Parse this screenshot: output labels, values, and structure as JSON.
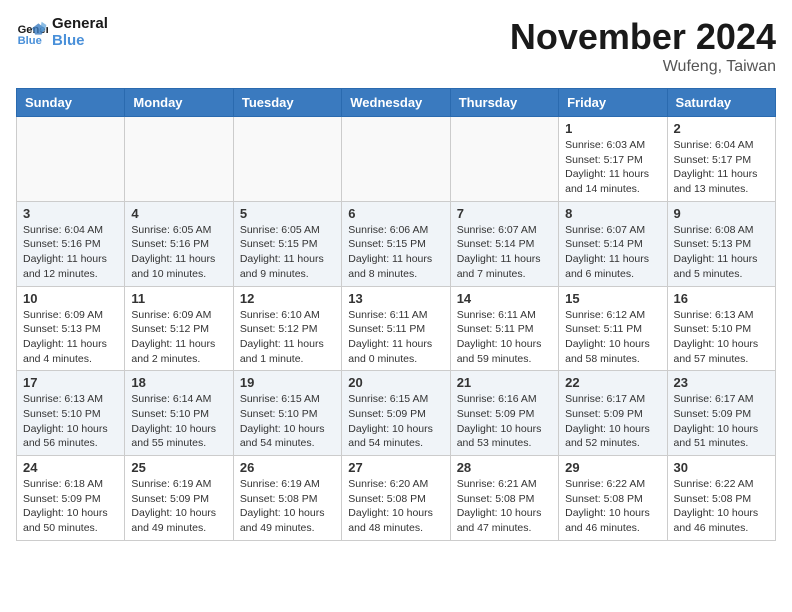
{
  "logo": {
    "line1": "General",
    "line2": "Blue"
  },
  "title": "November 2024",
  "location": "Wufeng, Taiwan",
  "days_header": [
    "Sunday",
    "Monday",
    "Tuesday",
    "Wednesday",
    "Thursday",
    "Friday",
    "Saturday"
  ],
  "weeks": [
    [
      {
        "day": "",
        "info": ""
      },
      {
        "day": "",
        "info": ""
      },
      {
        "day": "",
        "info": ""
      },
      {
        "day": "",
        "info": ""
      },
      {
        "day": "",
        "info": ""
      },
      {
        "day": "1",
        "info": "Sunrise: 6:03 AM\nSunset: 5:17 PM\nDaylight: 11 hours and 14 minutes."
      },
      {
        "day": "2",
        "info": "Sunrise: 6:04 AM\nSunset: 5:17 PM\nDaylight: 11 hours and 13 minutes."
      }
    ],
    [
      {
        "day": "3",
        "info": "Sunrise: 6:04 AM\nSunset: 5:16 PM\nDaylight: 11 hours and 12 minutes."
      },
      {
        "day": "4",
        "info": "Sunrise: 6:05 AM\nSunset: 5:16 PM\nDaylight: 11 hours and 10 minutes."
      },
      {
        "day": "5",
        "info": "Sunrise: 6:05 AM\nSunset: 5:15 PM\nDaylight: 11 hours and 9 minutes."
      },
      {
        "day": "6",
        "info": "Sunrise: 6:06 AM\nSunset: 5:15 PM\nDaylight: 11 hours and 8 minutes."
      },
      {
        "day": "7",
        "info": "Sunrise: 6:07 AM\nSunset: 5:14 PM\nDaylight: 11 hours and 7 minutes."
      },
      {
        "day": "8",
        "info": "Sunrise: 6:07 AM\nSunset: 5:14 PM\nDaylight: 11 hours and 6 minutes."
      },
      {
        "day": "9",
        "info": "Sunrise: 6:08 AM\nSunset: 5:13 PM\nDaylight: 11 hours and 5 minutes."
      }
    ],
    [
      {
        "day": "10",
        "info": "Sunrise: 6:09 AM\nSunset: 5:13 PM\nDaylight: 11 hours and 4 minutes."
      },
      {
        "day": "11",
        "info": "Sunrise: 6:09 AM\nSunset: 5:12 PM\nDaylight: 11 hours and 2 minutes."
      },
      {
        "day": "12",
        "info": "Sunrise: 6:10 AM\nSunset: 5:12 PM\nDaylight: 11 hours and 1 minute."
      },
      {
        "day": "13",
        "info": "Sunrise: 6:11 AM\nSunset: 5:11 PM\nDaylight: 11 hours and 0 minutes."
      },
      {
        "day": "14",
        "info": "Sunrise: 6:11 AM\nSunset: 5:11 PM\nDaylight: 10 hours and 59 minutes."
      },
      {
        "day": "15",
        "info": "Sunrise: 6:12 AM\nSunset: 5:11 PM\nDaylight: 10 hours and 58 minutes."
      },
      {
        "day": "16",
        "info": "Sunrise: 6:13 AM\nSunset: 5:10 PM\nDaylight: 10 hours and 57 minutes."
      }
    ],
    [
      {
        "day": "17",
        "info": "Sunrise: 6:13 AM\nSunset: 5:10 PM\nDaylight: 10 hours and 56 minutes."
      },
      {
        "day": "18",
        "info": "Sunrise: 6:14 AM\nSunset: 5:10 PM\nDaylight: 10 hours and 55 minutes."
      },
      {
        "day": "19",
        "info": "Sunrise: 6:15 AM\nSunset: 5:10 PM\nDaylight: 10 hours and 54 minutes."
      },
      {
        "day": "20",
        "info": "Sunrise: 6:15 AM\nSunset: 5:09 PM\nDaylight: 10 hours and 54 minutes."
      },
      {
        "day": "21",
        "info": "Sunrise: 6:16 AM\nSunset: 5:09 PM\nDaylight: 10 hours and 53 minutes."
      },
      {
        "day": "22",
        "info": "Sunrise: 6:17 AM\nSunset: 5:09 PM\nDaylight: 10 hours and 52 minutes."
      },
      {
        "day": "23",
        "info": "Sunrise: 6:17 AM\nSunset: 5:09 PM\nDaylight: 10 hours and 51 minutes."
      }
    ],
    [
      {
        "day": "24",
        "info": "Sunrise: 6:18 AM\nSunset: 5:09 PM\nDaylight: 10 hours and 50 minutes."
      },
      {
        "day": "25",
        "info": "Sunrise: 6:19 AM\nSunset: 5:09 PM\nDaylight: 10 hours and 49 minutes."
      },
      {
        "day": "26",
        "info": "Sunrise: 6:19 AM\nSunset: 5:08 PM\nDaylight: 10 hours and 49 minutes."
      },
      {
        "day": "27",
        "info": "Sunrise: 6:20 AM\nSunset: 5:08 PM\nDaylight: 10 hours and 48 minutes."
      },
      {
        "day": "28",
        "info": "Sunrise: 6:21 AM\nSunset: 5:08 PM\nDaylight: 10 hours and 47 minutes."
      },
      {
        "day": "29",
        "info": "Sunrise: 6:22 AM\nSunset: 5:08 PM\nDaylight: 10 hours and 46 minutes."
      },
      {
        "day": "30",
        "info": "Sunrise: 6:22 AM\nSunset: 5:08 PM\nDaylight: 10 hours and 46 minutes."
      }
    ]
  ]
}
